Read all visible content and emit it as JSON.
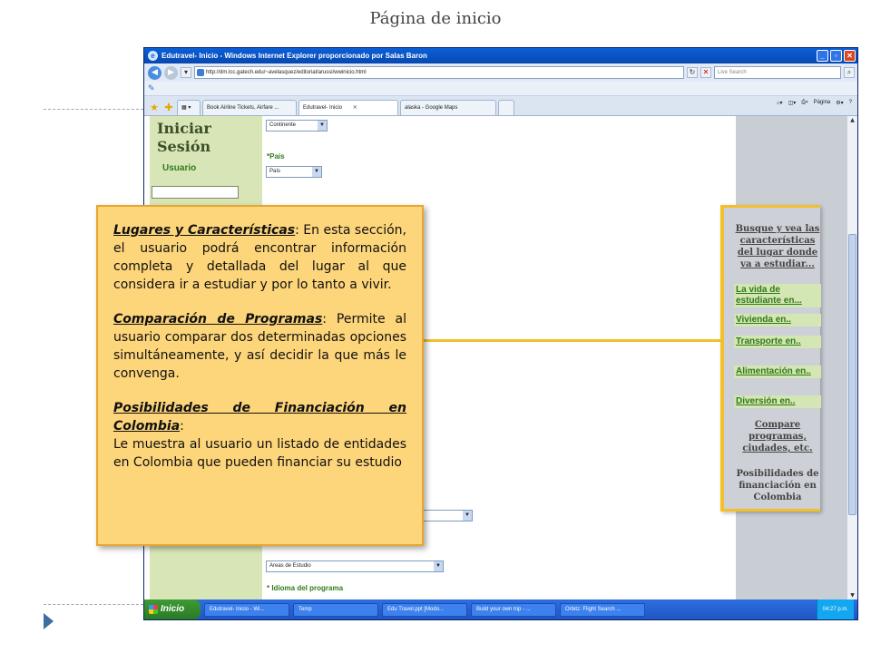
{
  "slide": {
    "title": "Página de inicio"
  },
  "window": {
    "title": "Edutravel- Inicio - Windows Internet Explorer proporcionado por Salas Baron",
    "address": "http://dm.lcc.gatech.edu/~avelasquez/editorial/arussi/wwinicio.html",
    "search_placeholder": "Live Search",
    "tabs": [
      "Book Airline Tickets, Airfare ...",
      "Edutravel- Inicio",
      "alaska - Google Maps"
    ],
    "tools": {
      "page": "Página"
    }
  },
  "left": {
    "login_title": "Iniciar Sesión",
    "user_label": "Usuario"
  },
  "form": {
    "continent": "Continente",
    "country_label": "*Pais",
    "country": "País",
    "areas": "Areas de Estudio",
    "language_label": "* Idioma del programa"
  },
  "right_menu": {
    "heading": "Busque y vea las características del lugar donde va a estudiar...",
    "items": [
      "La vida de estudiante en...",
      "Vivienda en..",
      "Transporte en..",
      "Alimentación en..",
      "Diversión en.."
    ],
    "compare": "Compare programas, ciudades, etc.",
    "financing": "Posibilidades de financiación en Colombia"
  },
  "popup": {
    "p1_title": "Lugares y Características",
    "p1_text": ": En esta sección, el usuario podrá encontrar información completa y detallada del lugar al que considera ir a estudiar y por lo tanto a vivir.",
    "p2_title": "Comparación de Programas",
    "p2_text": ": Permite al usuario comparar dos determinadas opciones simultáneamente, y así decidir la que más le convenga.",
    "p3_title": "Posibilidades de Financiación en Colombia",
    "p3_colon": ":",
    "p3_text": "Le muestra al usuario un listado de entidades en Colombia que pueden financiar su estudio"
  },
  "taskbar": {
    "start": "Inicio",
    "items": [
      "Edutravel- Inicio - Wi...",
      "Temp",
      "Edu Travel.ppt [Modo...",
      "Build your own trip - ...",
      "Orbitz: Flight Search ..."
    ],
    "clock": "04:27 p.m."
  },
  "colors": {
    "popup_bg": "#fdd57a",
    "accent_bracket": "#f5bf2a",
    "login_panel": "#d8e6b7"
  }
}
